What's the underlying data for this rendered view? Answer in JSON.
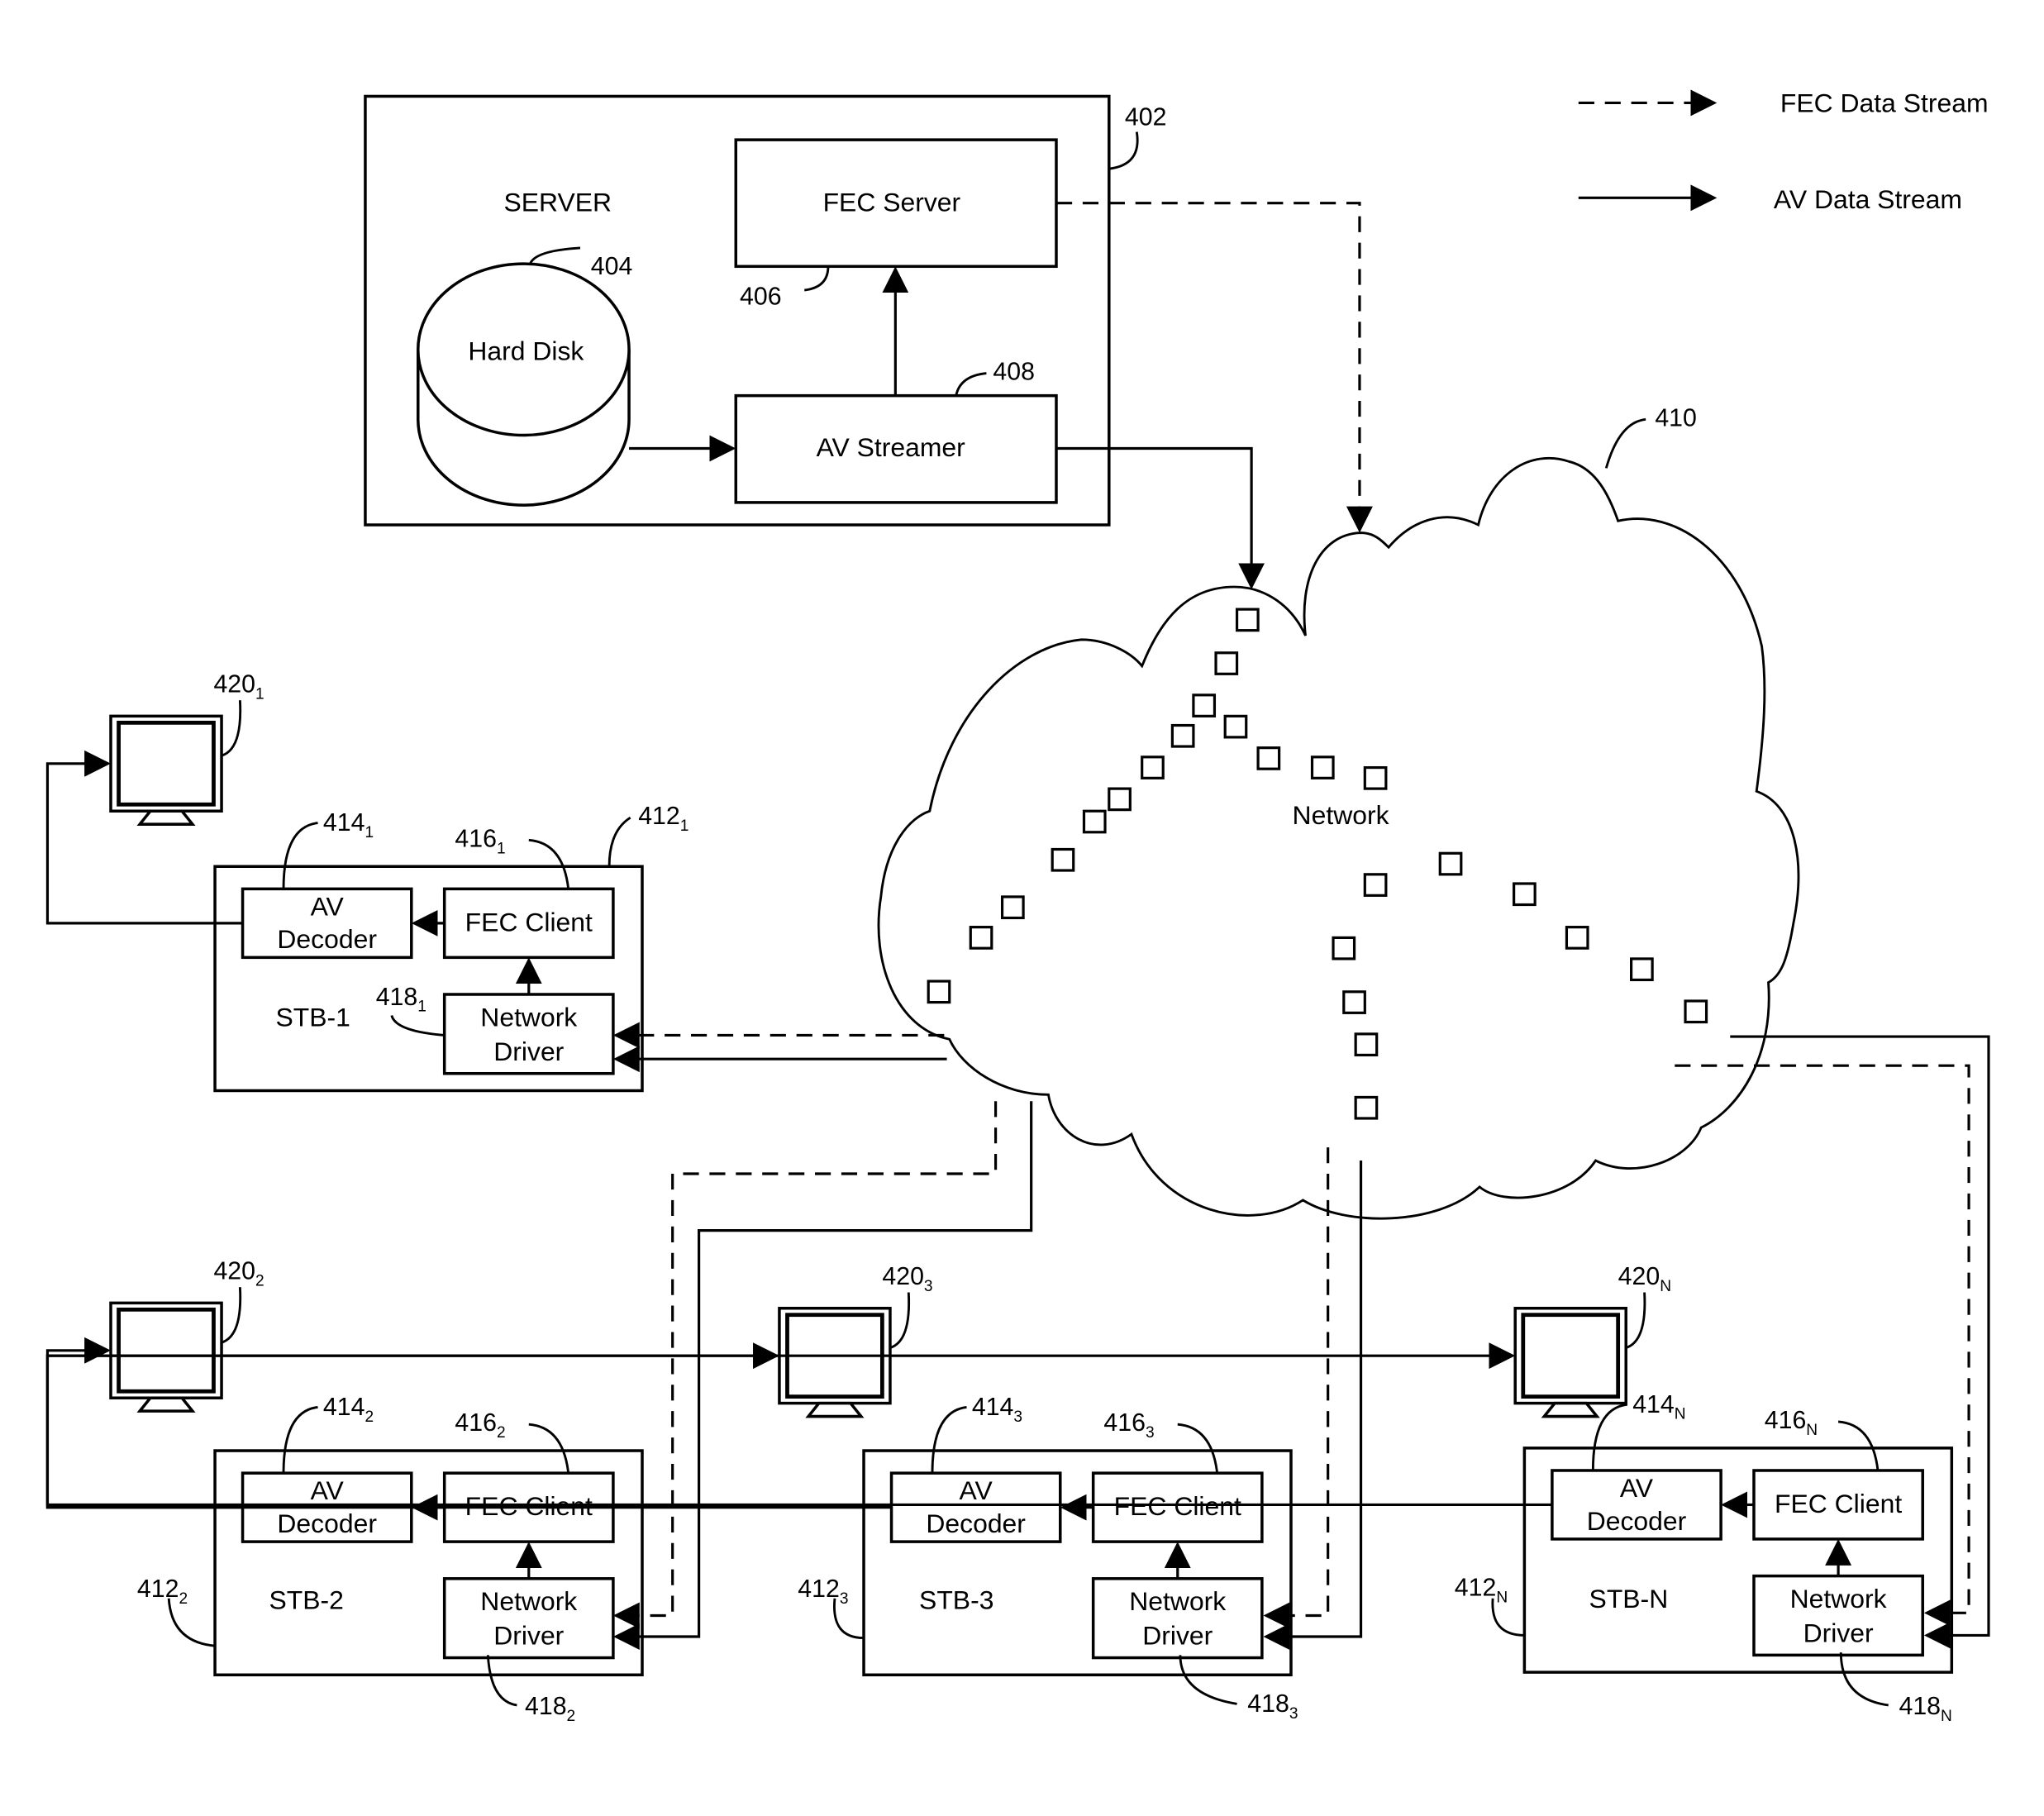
{
  "legend": {
    "fec_stream": "FEC Data Stream",
    "av_stream": "AV Data Stream"
  },
  "server": {
    "label": "SERVER",
    "ref": "402",
    "fec_server": {
      "label": "FEC Server",
      "ref": "406"
    },
    "hard_disk": {
      "label": "Hard Disk",
      "ref": "404"
    },
    "av_streamer": {
      "label": "AV Streamer",
      "ref": "408"
    }
  },
  "network": {
    "label": "Network",
    "ref": "410"
  },
  "stbs": [
    {
      "name": "STB-1",
      "ref": "412",
      "sub": "1",
      "av_decoder": [
        "AV",
        "Decoder"
      ],
      "av_ref": "414",
      "fec_client": "FEC Client",
      "fec_ref": "416",
      "net_driver": [
        "Network",
        "Driver"
      ],
      "nd_ref": "418",
      "tv_ref": "420"
    },
    {
      "name": "STB-2",
      "ref": "412",
      "sub": "2",
      "av_decoder": [
        "AV",
        "Decoder"
      ],
      "av_ref": "414",
      "fec_client": "FEC Client",
      "fec_ref": "416",
      "net_driver": [
        "Network",
        "Driver"
      ],
      "nd_ref": "418",
      "tv_ref": "420"
    },
    {
      "name": "STB-3",
      "ref": "412",
      "sub": "3",
      "av_decoder": [
        "AV",
        "Decoder"
      ],
      "av_ref": "414",
      "fec_client": "FEC Client",
      "fec_ref": "416",
      "net_driver": [
        "Network",
        "Driver"
      ],
      "nd_ref": "418",
      "tv_ref": "420"
    },
    {
      "name": "STB-N",
      "ref": "412",
      "sub": "N",
      "av_decoder": [
        "AV",
        "Decoder"
      ],
      "av_ref": "414",
      "fec_client": "FEC Client",
      "fec_ref": "416",
      "net_driver": [
        "Network",
        "Driver"
      ],
      "nd_ref": "418",
      "tv_ref": "420"
    }
  ]
}
